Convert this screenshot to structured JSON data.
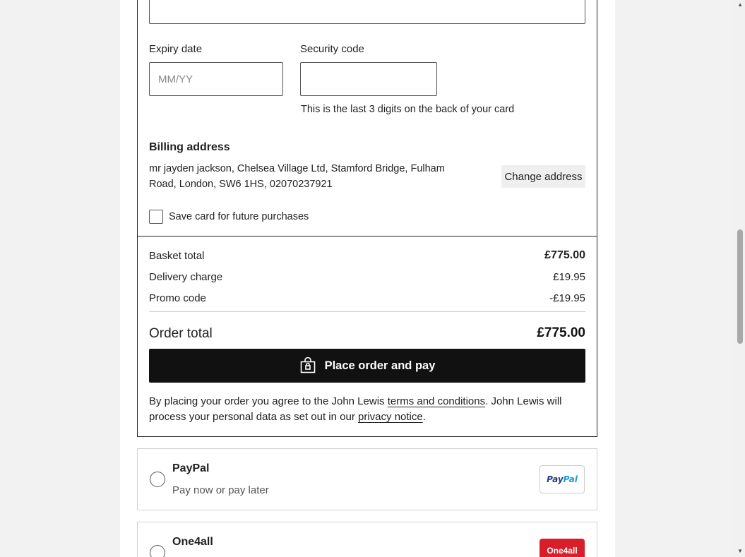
{
  "card_form": {
    "expiry_label": "Expiry date",
    "expiry_placeholder": "MM/YY",
    "security_label": "Security code",
    "security_hint": "This is the last 3 digits on the back of your card"
  },
  "billing": {
    "heading": "Billing address",
    "address_line1": "mr jayden jackson, Chelsea Village Ltd, Stamford Bridge, Fulham",
    "address_line2": "Road, London, SW6 1HS, 02070237921",
    "change_label": "Change address",
    "save_card_label": "Save card for future purchases"
  },
  "summary": {
    "basket_label": "Basket total",
    "basket_value": "£775.00",
    "delivery_label": "Delivery charge",
    "delivery_value": "£19.95",
    "promo_label": "Promo code",
    "promo_value": "-£19.95",
    "order_total_label": "Order total",
    "order_total_value": "£775.00"
  },
  "actions": {
    "place_order_label": "Place order and pay"
  },
  "legal": {
    "part1": "By placing your order you agree to the John Lewis ",
    "terms_link": "terms and conditions",
    "part2": ". John Lewis will process your personal data as set out in our ",
    "privacy_link": "privacy notice",
    "part3": "."
  },
  "payment_options": [
    {
      "title": "PayPal",
      "subtitle": "Pay now or pay later",
      "logo_part1": "Pay",
      "logo_part2": "Pal"
    },
    {
      "title": "One4all",
      "logo_text": "One4all"
    }
  ],
  "colors": {
    "primary_button": "#111111",
    "border": "#222222",
    "one4all_red": "#d81e28",
    "paypal_dark": "#253b80",
    "paypal_light": "#179bd7"
  }
}
